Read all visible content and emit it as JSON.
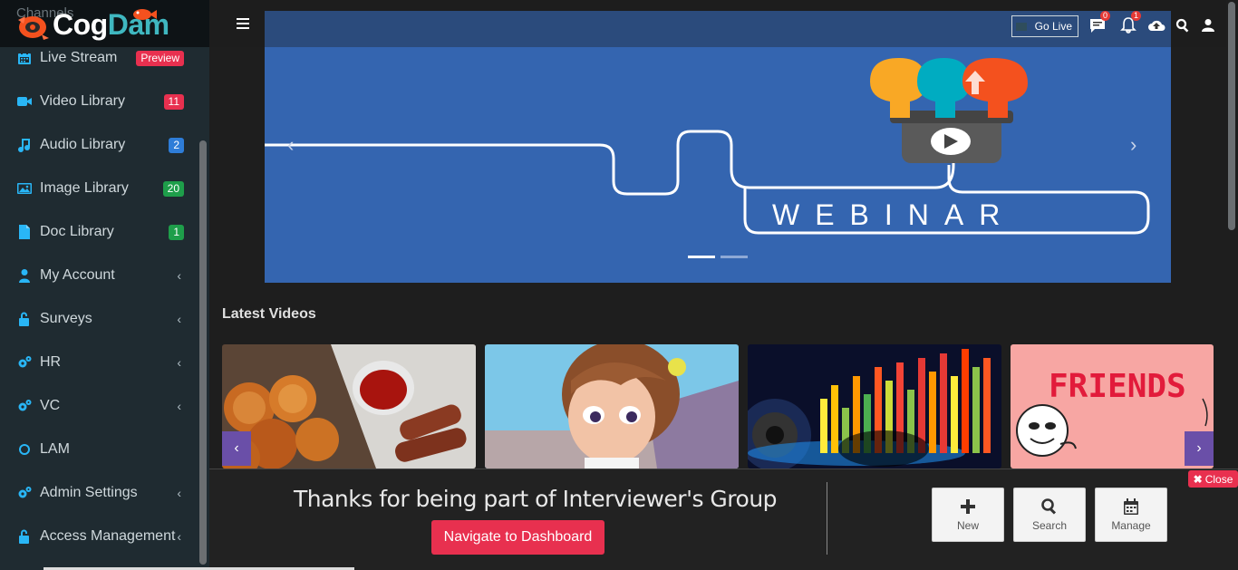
{
  "brand": {
    "ghost_text": "Channels",
    "name_part1": "Cog",
    "name_part2": "Dam"
  },
  "sidebar": {
    "items": [
      {
        "label": "Live Stream",
        "icon": "calendar-icon",
        "badge": "Preview",
        "badge_color": "#e8304f"
      },
      {
        "label": "Video Library",
        "icon": "video-camera-icon",
        "badge": "11",
        "badge_color": "#e8304f"
      },
      {
        "label": "Audio Library",
        "icon": "music-note-icon",
        "badge": "2",
        "badge_color": "#2e7dd8"
      },
      {
        "label": "Image Library",
        "icon": "image-icon",
        "badge": "20",
        "badge_color": "#1e9e4a"
      },
      {
        "label": "Doc Library",
        "icon": "document-icon",
        "badge": "1",
        "badge_color": "#1e9e4a"
      },
      {
        "label": "My Account",
        "icon": "user-icon",
        "chevron": "‹"
      },
      {
        "label": "Surveys",
        "icon": "unlock-icon",
        "chevron": "‹"
      },
      {
        "label": "HR",
        "icon": "gears-icon",
        "chevron": "‹"
      },
      {
        "label": "VC",
        "icon": "gears-icon",
        "chevron": "‹"
      },
      {
        "label": "LAM",
        "icon": "circle-icon"
      },
      {
        "label": "Admin Settings",
        "icon": "gears-icon",
        "chevron": "‹"
      },
      {
        "label": "Access Management",
        "icon": "unlock-icon",
        "chevron": "‹"
      }
    ]
  },
  "topbar": {
    "go_live_label": "Go Live",
    "messages_count": "0",
    "notifications_count": "1"
  },
  "carousel": {
    "banner_text": "WEBINAR",
    "prev": "‹",
    "next": "›",
    "slide_count": 2,
    "active_slide": 0
  },
  "latest_videos": {
    "title": "Latest Videos",
    "thumbnails": [
      {
        "name": "fried-food-thumbnail"
      },
      {
        "name": "cartoon-girl-thumbnail"
      },
      {
        "name": "equalizer-speaker-thumbnail"
      },
      {
        "name": "friends-thumbnail",
        "caption": "FRIENDS"
      }
    ],
    "prev": "‹",
    "next": "›"
  },
  "bottom_panel": {
    "message": "Thanks for being part of Interviewer's Group",
    "dashboard_button": "Navigate to Dashboard",
    "close_label": "Close",
    "actions": [
      {
        "label": "New",
        "icon": "plus-icon"
      },
      {
        "label": "Search",
        "icon": "search-icon"
      },
      {
        "label": "Manage",
        "icon": "calendar-icon"
      }
    ]
  },
  "colors": {
    "sidebar_bg": "#1f2b31",
    "accent_blue": "#29b6f6",
    "carousel_bg": "#3465b0",
    "primary_red": "#e8304f",
    "slider_purple": "#6a4fa8"
  }
}
